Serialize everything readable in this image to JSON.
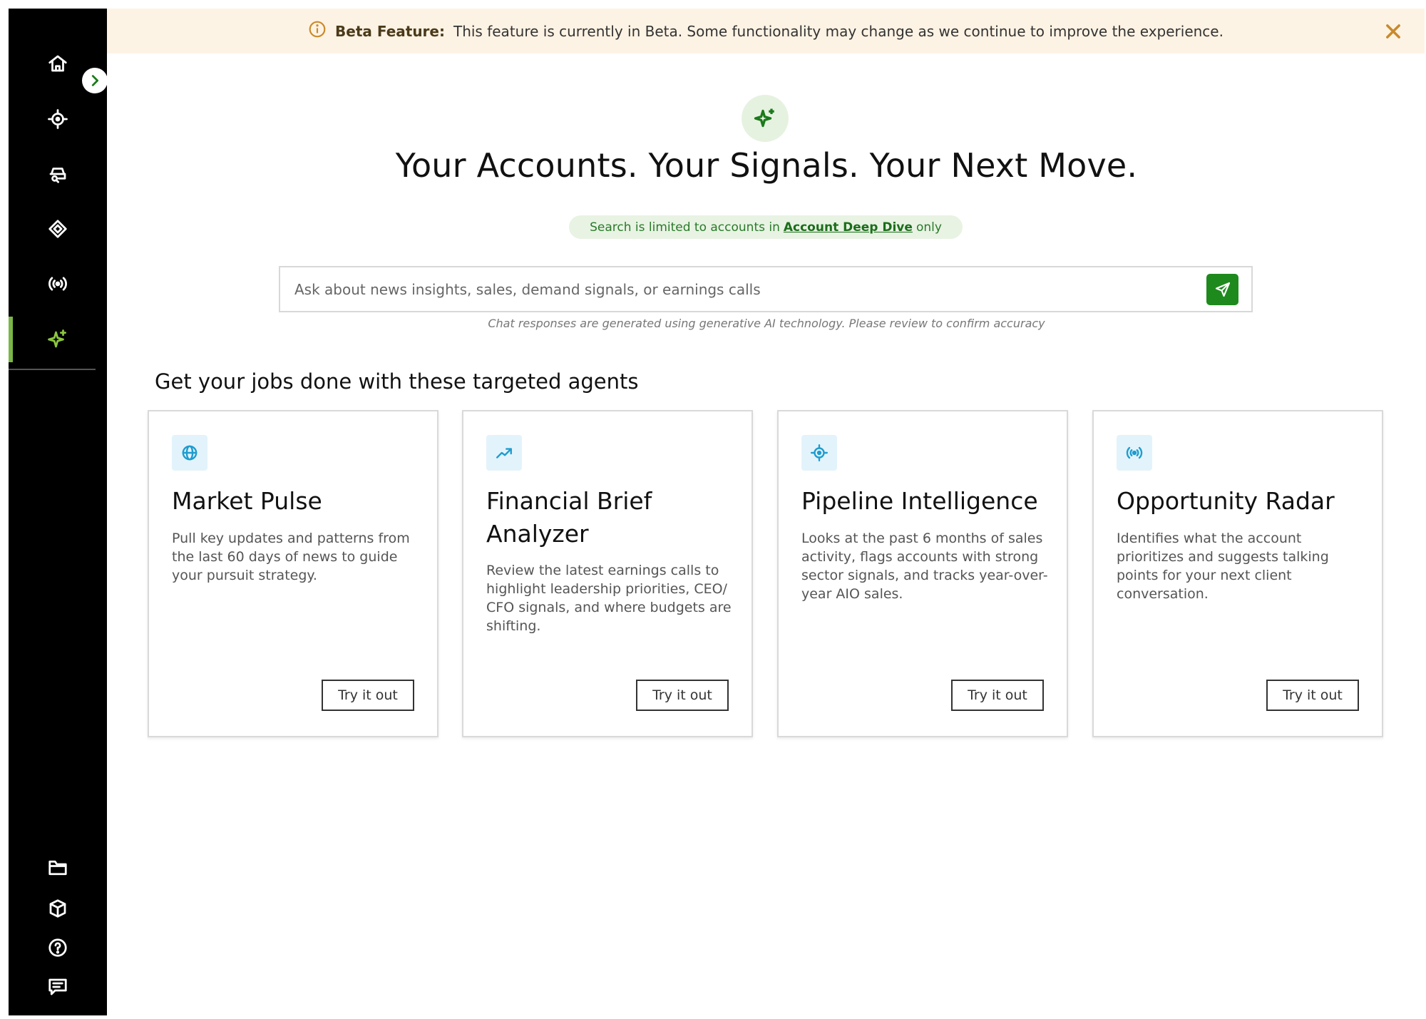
{
  "banner": {
    "title": "Beta Feature:",
    "text": "This feature is currently in Beta. Some functionality may change as we continue to improve the experience."
  },
  "hero": {
    "title": "Your Accounts. Your Signals. Your Next Move.",
    "limit_prefix": "Search is limited to accounts in",
    "limit_link": "Account Deep Dive",
    "limit_suffix": "only"
  },
  "chat": {
    "placeholder": "Ask about news insights, sales, demand signals, or earnings calls",
    "disclaimer": "Chat responses are generated using generative AI technology. Please review to confirm accuracy"
  },
  "section": {
    "title": "Get your jobs done with these targeted agents"
  },
  "cards": [
    {
      "title": "Market Pulse",
      "description": "Pull key updates and patterns from the last 60 days of news to guide your pursuit strategy.",
      "button": "Try it out",
      "icon": "globe-icon"
    },
    {
      "title": "Financial Brief Analyzer",
      "description": "Review the latest earnings calls to highlight leadership priorities, CEO/ CFO signals, and where budgets are shifting.",
      "button": "Try it out",
      "icon": "trending-up-icon"
    },
    {
      "title": "Pipeline Intelligence",
      "description": "Looks at the past 6 months of sales activity, flags accounts with strong sector signals, and tracks year-over-year AIO sales.",
      "button": "Try it out",
      "icon": "target-icon"
    },
    {
      "title": "Opportunity Radar",
      "description": "Identifies what the account prioritizes and suggests talking points for your next client conversation.",
      "button": "Try it out",
      "icon": "broadcast-icon"
    }
  ],
  "sidebar": {
    "top_items": [
      "home-icon",
      "target-icon",
      "car-search-icon",
      "tag-icon",
      "broadcast-icon",
      "sparkle-icon"
    ],
    "active_item": "sparkle-icon",
    "bottom_items": [
      "folder-icon",
      "cube-icon",
      "help-icon",
      "feedback-icon"
    ]
  },
  "colors": {
    "accent_green": "#1e8a1e",
    "banner_bg": "#fdf3e4",
    "sidebar_bg": "#000000",
    "card_icon_blue": "#1f9ccf"
  }
}
